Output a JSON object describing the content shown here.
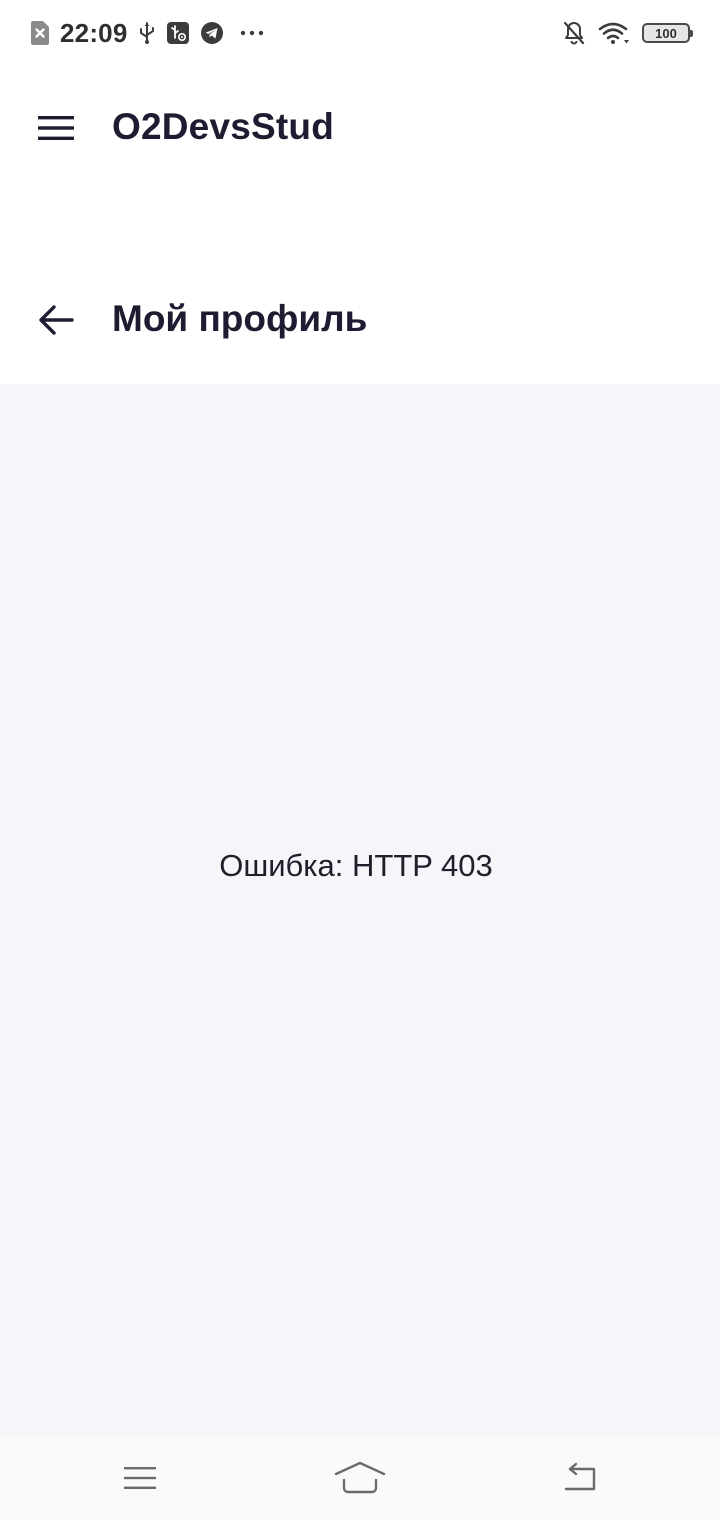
{
  "status_bar": {
    "time": "22:09",
    "icons_left": [
      "sim-card-x-icon",
      "usb-icon",
      "usb-debug-icon",
      "telegram-icon",
      "more-dots-icon"
    ],
    "icons_right": [
      "bell-off-icon",
      "wifi-icon",
      "battery-icon"
    ],
    "battery_level": "100"
  },
  "app_bar": {
    "title": "O2DevsStud",
    "menu_icon": "hamburger-menu-icon"
  },
  "sub_header": {
    "title": "Мой профиль",
    "back_icon": "arrow-left-icon"
  },
  "content": {
    "error_message": "Ошибка: HTTP 403"
  },
  "nav_bar": {
    "buttons": [
      "recents-icon",
      "home-icon",
      "back-icon"
    ]
  },
  "colors": {
    "title_text": "#1d1c31",
    "content_background": "#f5f5fa",
    "surface": "#ffffff"
  }
}
